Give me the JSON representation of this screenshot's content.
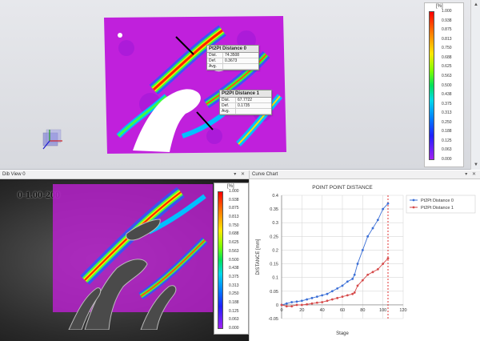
{
  "top_view": {
    "infoboxes": [
      {
        "title": "Pt2Pt Distance 0",
        "rows": [
          {
            "key": "Dist.",
            "value": "74.3508"
          },
          {
            "key": "Def.",
            "value": "0.3673"
          },
          {
            "key": "Avg.",
            "value": ""
          }
        ]
      },
      {
        "title": "Pt2Pt Distance 1",
        "rows": [
          {
            "key": "Dist.",
            "value": "67.7722"
          },
          {
            "key": "Def.",
            "value": "0.1735"
          },
          {
            "key": "Avg.",
            "value": ""
          }
        ]
      }
    ],
    "legend": {
      "unit": "[%]",
      "labels": [
        "1.000",
        "0.938",
        "0.875",
        "0.813",
        "0.750",
        "0.688",
        "0.625",
        "0.563",
        "0.500",
        "0.438",
        "0.375",
        "0.313",
        "0.250",
        "0.188",
        "0.125",
        "0.063",
        "0.000"
      ]
    }
  },
  "panels": {
    "dib_view": {
      "title": "Dib View 0",
      "controls": "▾ ✕"
    },
    "curve_chart": {
      "title": "Curve Chart",
      "controls": "▾ ✕"
    }
  },
  "dib": {
    "stamp": "0-1.00-200",
    "legend": {
      "unit": "[%]",
      "labels": [
        "1.000",
        "0.938",
        "0.875",
        "0.813",
        "0.750",
        "0.688",
        "0.625",
        "0.563",
        "0.500",
        "0.438",
        "0.375",
        "0.313",
        "0.250",
        "0.188",
        "0.125",
        "0.063",
        "0.000"
      ]
    }
  },
  "colors": {
    "accent_series0": "#3b6fd6",
    "accent_series1": "#d64a4a",
    "marker_line": "#e03030",
    "magenta_field": "#c21fd9"
  },
  "chart_data": {
    "type": "line",
    "title": "POINT POINT DISTANCE",
    "xlabel": "Stage",
    "ylabel": "DISTANCE [mm]",
    "xlim": [
      0,
      120
    ],
    "ylim": [
      -0.05,
      0.4
    ],
    "xticks": [
      0,
      20,
      40,
      60,
      80,
      100,
      120
    ],
    "yticks": [
      -0.05,
      0,
      0.05,
      0.1,
      0.15,
      0.2,
      0.25,
      0.3,
      0.35,
      0.4
    ],
    "grid": true,
    "legend_position": "top-right",
    "vline_x": 105,
    "series": [
      {
        "name": "Pt2Pt Distance 0",
        "color": "#3b6fd6",
        "x": [
          0,
          5,
          10,
          15,
          20,
          25,
          30,
          35,
          40,
          45,
          50,
          55,
          60,
          65,
          70,
          72,
          75,
          80,
          85,
          90,
          95,
          100,
          105
        ],
        "y": [
          0,
          0.005,
          0.01,
          0.012,
          0.015,
          0.02,
          0.025,
          0.03,
          0.035,
          0.04,
          0.05,
          0.06,
          0.07,
          0.085,
          0.095,
          0.11,
          0.15,
          0.2,
          0.25,
          0.28,
          0.31,
          0.35,
          0.37
        ]
      },
      {
        "name": "Pt2Pt Distance 1",
        "color": "#d64a4a",
        "x": [
          0,
          5,
          10,
          15,
          20,
          25,
          30,
          35,
          40,
          45,
          50,
          55,
          60,
          65,
          70,
          72,
          75,
          80,
          85,
          90,
          95,
          100,
          105
        ],
        "y": [
          0,
          -0.005,
          -0.005,
          0,
          0,
          0.002,
          0.005,
          0.008,
          0.01,
          0.015,
          0.02,
          0.025,
          0.03,
          0.035,
          0.04,
          0.045,
          0.07,
          0.09,
          0.11,
          0.12,
          0.13,
          0.15,
          0.17
        ]
      }
    ]
  }
}
